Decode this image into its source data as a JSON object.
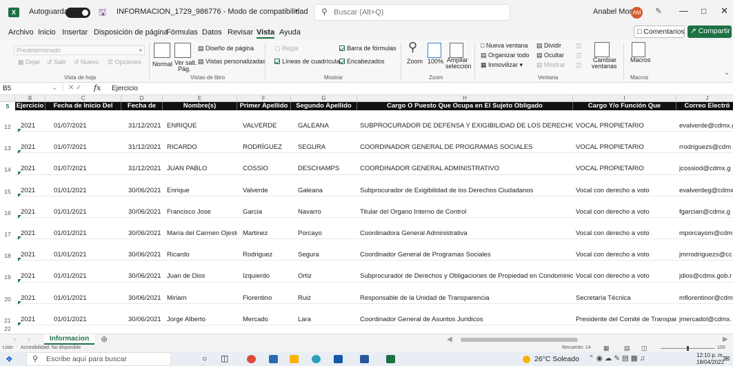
{
  "titlebar": {
    "autosave": "Autoguardado",
    "filename": "INFORMACION_1729_986776 - Modo de compatibilidad",
    "search_placeholder": "Buscar (Alt+Q)",
    "user": "Anabel Mora",
    "user_initials": "AM"
  },
  "menu": {
    "items": [
      "Archivo",
      "Inicio",
      "Insertar",
      "Disposición de página",
      "Fórmulas",
      "Datos",
      "Revisar",
      "Vista",
      "Ayuda"
    ],
    "active": "Vista",
    "comments": "Comentarios",
    "share": "Compartir"
  },
  "ribbon": {
    "sheet_view": {
      "dropdown": "Predeterminado",
      "keep": "Dejar",
      "exit": "Salir",
      "new": "Nuevo",
      "options": "Opciones",
      "label": "Vista de hoja"
    },
    "workbook_views": {
      "normal": "Normal",
      "page_break": "Ver salt.",
      "page_break2": "Pág.",
      "page_layout": "Diseño de página",
      "custom": "Vistas personalizadas",
      "label": "Vistas de libro"
    },
    "show": {
      "ruler": "Regla",
      "formula_bar": "Barra de fórmulas",
      "gridlines": "Líneas de cuadrícula",
      "headings": "Encabezados",
      "label": "Mostrar"
    },
    "zoom": {
      "zoom": "Zoom",
      "pct": "100%",
      "selection": "Ampliar",
      "selection2": "selección",
      "label": "Zoom"
    },
    "window": {
      "new": "Nueva ventana",
      "arrange": "Organizar todo",
      "freeze": "Inmovilizar",
      "split": "Dividir",
      "hide": "Ocultar",
      "show": "Mostrar",
      "switch": "Cambiar",
      "switch2": "ventanas",
      "label": "Ventana"
    },
    "macros": {
      "macros": "Macros",
      "label": "Macros"
    }
  },
  "formula_bar": {
    "cell_ref": "B5",
    "fx": "fx",
    "content": "Ejercicio"
  },
  "columns": [
    {
      "letter": "B",
      "header": "Ejercicio"
    },
    {
      "letter": "C",
      "header": "Fecha de Inicio Del"
    },
    {
      "letter": "D",
      "header": "Fecha de"
    },
    {
      "letter": "E",
      "header": "Nombre(s)"
    },
    {
      "letter": "F",
      "header": "Primer Apellido"
    },
    {
      "letter": "G",
      "header": "Segundo Apellido"
    },
    {
      "letter": "H",
      "header": "Cargo O Puesto Que Ocupa en El Sujeto Obligado"
    },
    {
      "letter": "I",
      "header": "Cargo Y/o Función Que"
    },
    {
      "letter": "J",
      "header": "Correo Electró"
    }
  ],
  "header_row_num": "5",
  "rows": [
    {
      "num": "12",
      "cells": [
        "2021",
        "01/07/2021",
        "31/12/2021",
        "ENRIQUE",
        "VALVERDE",
        "GALEANA",
        "SUBPROCURADOR DE DEFENSA Y EXIGIBILIDAD DE LOS DERECHOS C",
        "VOCAL PROPIETARIO",
        "evalverde@cdmx.g"
      ]
    },
    {
      "num": "13",
      "cells": [
        "2021",
        "01/07/2021",
        "31/12/2021",
        "RICARDO",
        "RODRÍGUEZ",
        "SEGURA",
        "COORDINADOR GENERAL DE PROGRAMAS SOCIALES",
        "VOCAL PROPIETARIO",
        "rrodriguezs@cdm"
      ]
    },
    {
      "num": "14",
      "cells": [
        "2021",
        "01/07/2021",
        "31/12/2021",
        "JUAN PABLO",
        "COSSIO",
        "DESCHAMPS",
        "COORDINADOR GENERAL ADMINISTRATIVO",
        "VOCAL PROPIETARIO",
        "jcossiod@cdmx.g"
      ]
    },
    {
      "num": "15",
      "cells": [
        "2021",
        "01/01/2021",
        "30/06/2021",
        "Enrique",
        "Valverde",
        "Galeana",
        "Subprocurador de Exigibilidad de los Derechos Ciudadanos",
        "Vocal con derecho a voto",
        "evalverdeg@cdmx"
      ]
    },
    {
      "num": "16",
      "cells": [
        "2021",
        "01/01/2021",
        "30/06/2021",
        "Francisco Jose",
        "Garcia",
        "Navarro",
        "Titular del Organo Interno de Control",
        "Vocal con derecho a voto",
        "fgarcian@cdmx.g"
      ]
    },
    {
      "num": "17",
      "cells": [
        "2021",
        "01/01/2021",
        "30/06/2021",
        "María del Carmen Ojesto",
        "Martinez",
        "Porcayo",
        "Coordinadora General Administrativa",
        "Vocal con derecho a voto",
        "mporcayom@cdm"
      ]
    },
    {
      "num": "18",
      "cells": [
        "2021",
        "01/01/2021",
        "30/06/2021",
        "Ricardo",
        "Rodriguez",
        "Segura",
        "Coordinador General de Programas Sociales",
        "Vocal con derecho a voto",
        "jmrrodriguezs@cc"
      ]
    },
    {
      "num": "19",
      "cells": [
        "2021",
        "01/01/2021",
        "30/06/2021",
        "Juan de Dios",
        "Izquierdo",
        "Ortiz",
        "Subprocurador de Derechos y Obligaciones de Propiedad en Condominio",
        "Vocal con derecho a voto",
        "jdios@cdmx.gob.r"
      ]
    },
    {
      "num": "20",
      "cells": [
        "2021",
        "01/01/2021",
        "30/06/2021",
        "Miriam",
        "Florentino",
        "Ruiz",
        "Responsable de la Unidad de Transparencia",
        "Secretaría Técnica",
        "mflorentinor@cdm"
      ]
    },
    {
      "num": "21",
      "cells": [
        "2021",
        "01/01/2021",
        "30/06/2021",
        "Jorge Alberto",
        "Mercado",
        "Lara",
        "Coordinador General de Asuntos Juridicos",
        "Presidente del Comité de Transparer",
        "jmercadol@cdmx."
      ]
    }
  ],
  "extra_row": "22",
  "sheet_tab": "Informacion",
  "status": {
    "ready": "Listo",
    "accessibility": "Accesibilidad: No disponible",
    "count": "Recuento: 14",
    "zoom": "100"
  },
  "taskbar": {
    "search": "Escribe aquí para buscar",
    "weather": "26°C Soleado",
    "time": "12:10 p. m.",
    "date": "18/04/2022"
  },
  "colors": {
    "excel_green": "#1e7145",
    "header_bg": "#111111"
  }
}
